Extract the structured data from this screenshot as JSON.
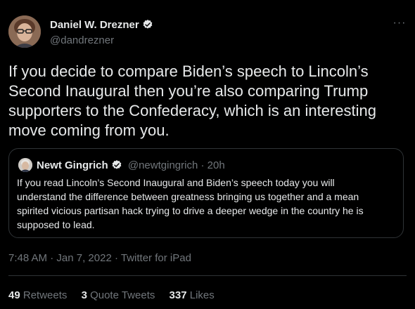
{
  "author": {
    "name": "Daniel W. Drezner",
    "handle": "@dandrezner",
    "verified": true
  },
  "more_label": "···",
  "tweet_text": "If you decide to compare Biden’s speech to Lincoln’s\nSecond Inaugural then you’re also comparing Trump\nsupporters to the Confederacy, which is an interesting\nmove coming from you.",
  "quote": {
    "name": "Newt Gingrich",
    "handle": "@newtgingrich",
    "separator": "·",
    "time": "20h",
    "text": "If you read Lincoln’s Second Inaugural and Biden’s speech today you will\nunderstand the difference between greatness bringing us together and a mean\nspirited vicious partisan hack trying to drive a deeper wedge in the country he is\nsupposed to lead."
  },
  "meta": {
    "time": "7:48 AM",
    "date": "Jan 7, 2022",
    "source": "Twitter for iPad",
    "separator": "·"
  },
  "stats": {
    "retweets_count": "49",
    "retweets_label": "Retweets",
    "quotes_count": "3",
    "quotes_label": "Quote Tweets",
    "likes_count": "337",
    "likes_label": "Likes"
  },
  "colors": {
    "background": "#000000",
    "text": "#e7e9ea",
    "secondary": "#71767b",
    "border": "#2f3336",
    "verified": "#1d9bf0"
  }
}
